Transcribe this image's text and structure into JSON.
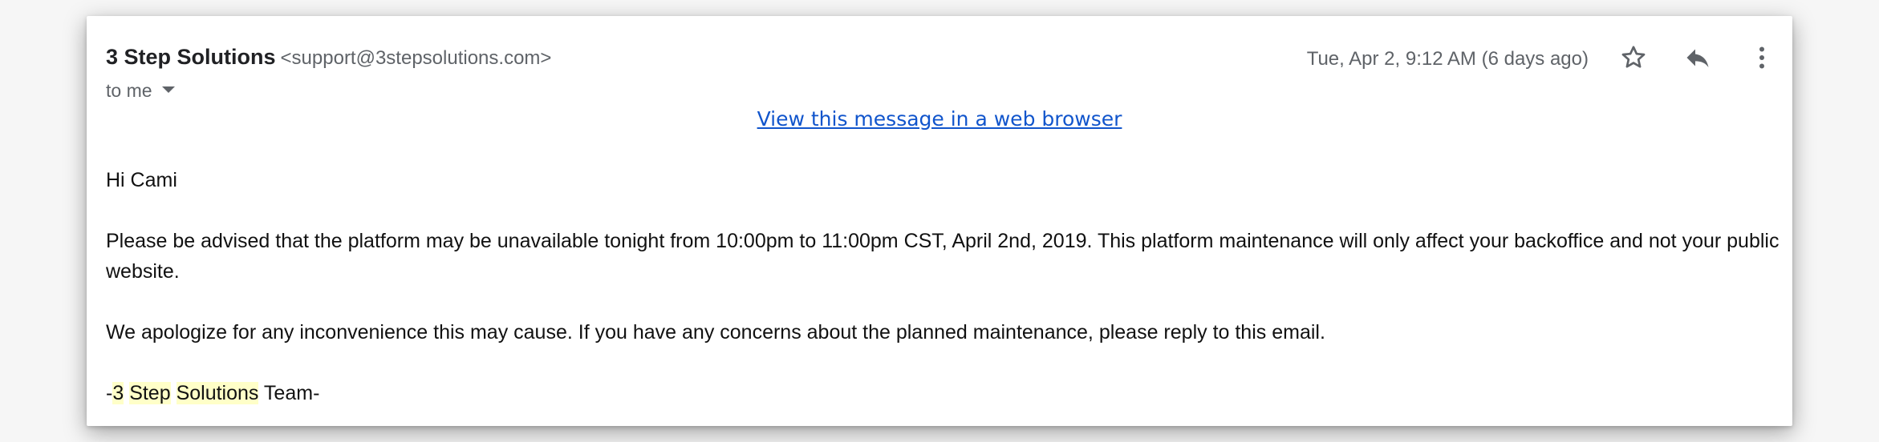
{
  "email": {
    "sender_name": "3 Step Solutions",
    "sender_email": "<support@3stepsolutions.com>",
    "to_label": "to me",
    "date": "Tue, Apr 2, 9:12 AM (6 days ago)",
    "icons": {
      "star": "star-outline-icon",
      "reply": "reply-icon",
      "more": "more-vertical-icon"
    }
  },
  "body": {
    "web_link": "View this message in a web browser",
    "greeting": "Hi Cami",
    "paragraph1": "Please be advised that the platform may be unavailable tonight from 10:00pm to 11:00pm CST, April 2nd, 2019. This platform maintenance will only affect your backoffice and not your public website.",
    "paragraph2": "We apologize for any inconvenience this may cause. If you have any concerns about the planned maintenance, please reply to this email.",
    "sign_prefix": "-",
    "sign_word1": "3",
    "sign_word2": "Step",
    "sign_word3": "Solutions",
    "sign_suffix": " Team-"
  },
  "colors": {
    "link": "#1155cc",
    "highlight": "#ffffc8",
    "secondary_text": "#5f6368"
  }
}
